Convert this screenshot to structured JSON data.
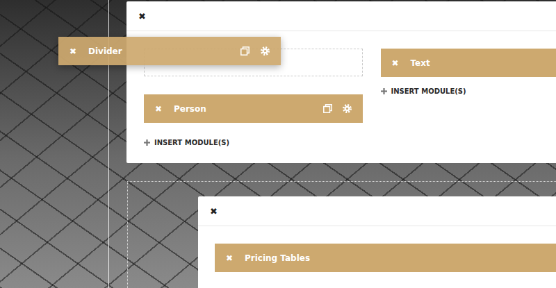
{
  "dragged_module": {
    "label": "Divider",
    "close": "✖",
    "actions": true
  },
  "sections": [
    {
      "rows": [
        {
          "close": "✖",
          "columns": [
            {
              "drop_placeholder": true,
              "modules": [
                {
                  "label": "Person",
                  "close": "✖",
                  "actions": true
                }
              ],
              "insert_label": "INSERT MODULE(S)"
            },
            {
              "drop_placeholder": false,
              "modules": [
                {
                  "label": "Text",
                  "close": "✖",
                  "actions": false
                }
              ],
              "insert_label": "INSERT MODULE(S)"
            }
          ]
        }
      ]
    },
    {
      "rows": [
        {
          "close": "✖",
          "columns": [
            {
              "drop_placeholder": false,
              "modules": [
                {
                  "label": "Pricing Tables",
                  "close": "✖",
                  "actions": false
                }
              ],
              "insert_label": ""
            }
          ]
        }
      ]
    }
  ]
}
